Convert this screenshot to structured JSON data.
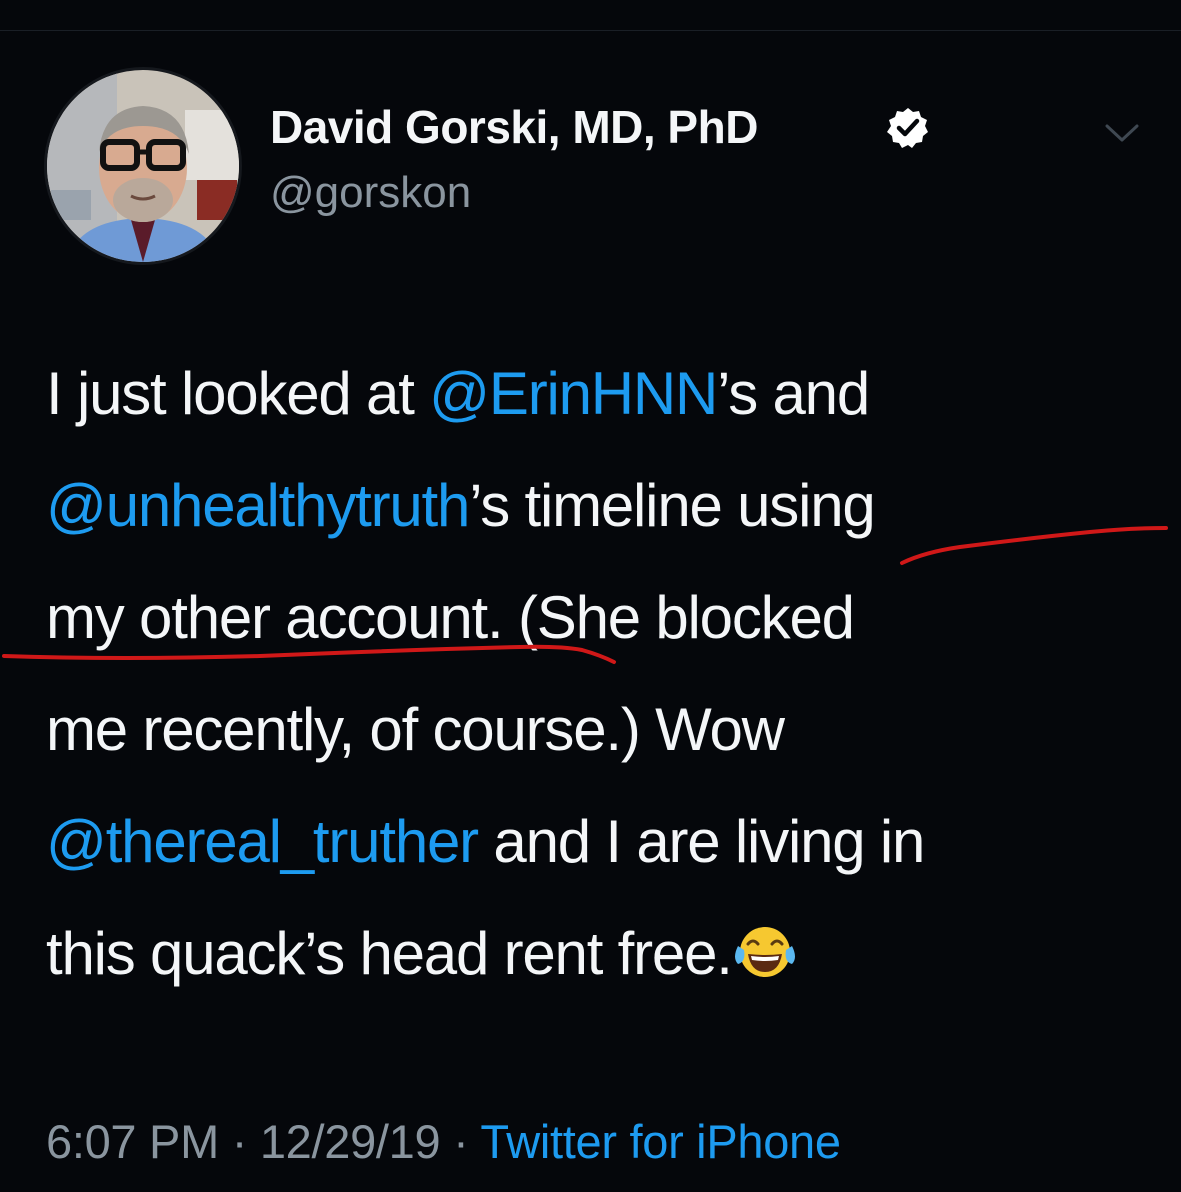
{
  "author": {
    "name": "David Gorski, MD, PhD",
    "handle": "@gorskon",
    "verified": true
  },
  "tweet": {
    "lines": [
      [
        {
          "text": "I just looked at ",
          "type": "text"
        },
        {
          "text": "@ErinHNN",
          "type": "mention"
        },
        {
          "text": "’s and",
          "type": "text"
        }
      ],
      [
        {
          "text": "@unhealthytruth",
          "type": "mention"
        },
        {
          "text": "’s timeline using",
          "type": "text"
        }
      ],
      [
        {
          "text": "my other account. (She blocked",
          "type": "text"
        }
      ],
      [
        {
          "text": "me recently, of course.) Wow",
          "type": "text"
        }
      ],
      [
        {
          "text": "@thereal_truther",
          "type": "mention"
        },
        {
          "text": " and I are living in",
          "type": "text"
        }
      ],
      [
        {
          "text": "this quack’s head rent free.",
          "type": "text"
        }
      ]
    ],
    "emoji": "face-with-tears-of-joy-icon"
  },
  "meta": {
    "time": "6:07 PM",
    "separator": " · ",
    "date": "12/29/19",
    "source": "Twitter for iPhone"
  },
  "icons": {
    "verified": "verified-badge-icon",
    "menu": "chevron-down-icon"
  },
  "colors": {
    "background": "#05070b",
    "text": "#f4f6f8",
    "mention": "#1d9bf0",
    "secondary": "#8a959f",
    "annotation": "#d01818"
  }
}
